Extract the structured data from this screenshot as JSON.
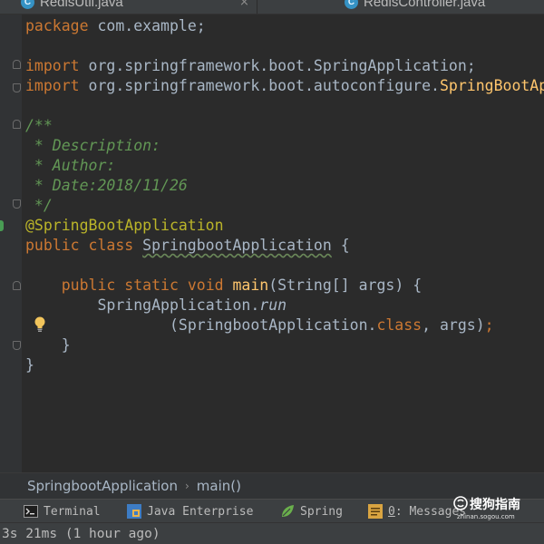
{
  "tabs": [
    {
      "label": "RedisUtil.java",
      "icon": "java-class-icon",
      "close": "×"
    },
    {
      "label": "RedisController.java",
      "icon": "java-class-icon"
    }
  ],
  "code": {
    "l1": {
      "kw": "package",
      "rest": " com.example;"
    },
    "l3": {
      "kw": "import",
      "rest": " org.springframework.boot.SpringApplication;"
    },
    "l4": {
      "kw": "import",
      "rest": " org.springframework.boot.autoconfigure.",
      "cls": "SpringBootAp"
    },
    "l6": "/**",
    "l7": " * Description:",
    "l8": " * Author:",
    "l9": " * Date:2018/11/26",
    "l10": " */",
    "l11": "@SpringBootApplication",
    "l12": {
      "kw": "public class ",
      "name": "SpringbootApplication",
      "rest": " {"
    },
    "l14": {
      "indent": "    ",
      "kw": "public static void ",
      "fn": "main",
      "rest": "(String[] args) {"
    },
    "l15": {
      "indent": "        ",
      "a": "SpringApplication.",
      "b": "run"
    },
    "l16": {
      "indent": "                ",
      "a": "(SpringbootApplication.",
      "b": "class",
      "c": ", args)",
      "d": ";"
    },
    "l17": "    }",
    "l18": "}"
  },
  "breadcrumb": {
    "class": "SpringbootApplication",
    "sep": "›",
    "method": "main()"
  },
  "toolwindows": {
    "terminal": "Terminal",
    "java_enterprise": "Java Enterprise",
    "spring": "Spring",
    "messages_num": "0",
    "messages_rest": ": Messages"
  },
  "watermark": {
    "title": "搜狗指南",
    "url": "zhinan.sogou.com"
  },
  "status": {
    "text": "3s 21ms (1 hour ago)"
  },
  "colors": {
    "keyword": "#cc7832",
    "method": "#ffc66d",
    "annotation": "#bbb529",
    "comment": "#629755",
    "text": "#a9b7c6"
  }
}
